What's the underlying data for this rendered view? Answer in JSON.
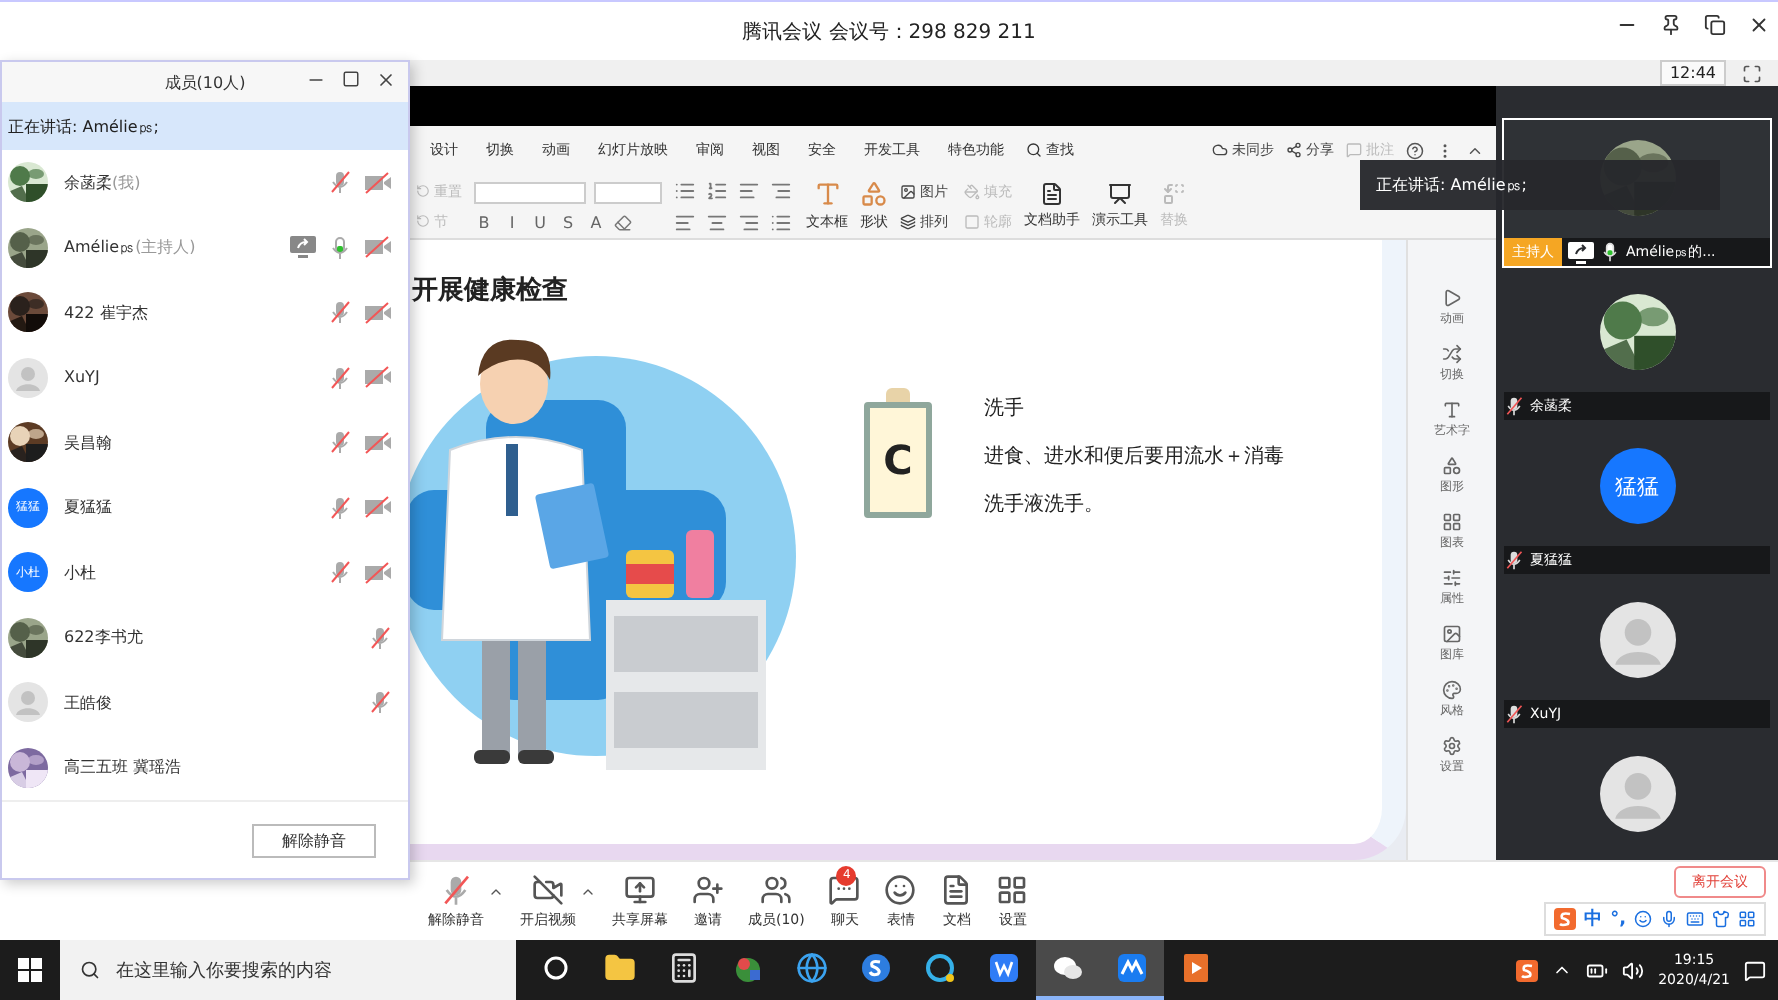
{
  "window": {
    "title": "腾讯会议 会议号：298 829 211"
  },
  "meeting_timer": "12:44",
  "ribbon": {
    "tabs": [
      "设计",
      "切换",
      "动画",
      "幻灯片放映",
      "审阅",
      "视图",
      "安全",
      "开发工具",
      "特色功能"
    ],
    "search": "查找",
    "actions": [
      {
        "label": "未同步",
        "kind": "cloud",
        "disabled": false
      },
      {
        "label": "分享",
        "kind": "share",
        "disabled": false
      },
      {
        "label": "批注",
        "kind": "comment",
        "disabled": true
      }
    ],
    "stack_tools": [
      {
        "label": "重置",
        "disabled": true
      },
      {
        "label": "节",
        "disabled": true
      }
    ],
    "format_buttons": [
      "B",
      "I",
      "U",
      "S",
      "A"
    ],
    "large_tools": [
      {
        "label": "文本框",
        "kind": "textbox"
      },
      {
        "label": "形状",
        "kind": "shape"
      }
    ],
    "grid_tools": [
      {
        "label": "图片",
        "kind": "picture",
        "disabled": false
      },
      {
        "label": "填充",
        "kind": "fill",
        "disabled": true
      },
      {
        "label": "排列",
        "kind": "arrange",
        "disabled": false
      },
      {
        "label": "轮廓",
        "kind": "outline",
        "disabled": true
      }
    ],
    "assist_tools": [
      {
        "label": "文档助手",
        "kind": "assistant",
        "disabled": false
      },
      {
        "label": "演示工具",
        "kind": "present",
        "disabled": false
      },
      {
        "label": "替换",
        "kind": "replace",
        "disabled": true
      }
    ]
  },
  "slide": {
    "title": "开展健康检查",
    "card_letter": "C",
    "heading": "洗手",
    "body": "进食、进水和便后要用流水＋消毒洗手液洗手。"
  },
  "side_panel": [
    {
      "label": "动画",
      "kind": "animation"
    },
    {
      "label": "切换",
      "kind": "transition"
    },
    {
      "label": "艺术字",
      "kind": "wordart"
    },
    {
      "label": "图形",
      "kind": "shape"
    },
    {
      "label": "图表",
      "kind": "chart"
    },
    {
      "label": "属性",
      "kind": "property"
    },
    {
      "label": "图库",
      "kind": "library"
    },
    {
      "label": "风格",
      "kind": "style"
    },
    {
      "label": "设置",
      "kind": "settings"
    }
  ],
  "speaking_tooltip": "正在讲话: Amélie㎰;",
  "members_panel": {
    "title": "成员(10人)",
    "speaking": "正在讲话: Amélie㎰;",
    "members": [
      {
        "name": "余菡柔",
        "tag": "(我)",
        "kind": "picture",
        "sharing": false,
        "muted": true,
        "camera_off": true
      },
      {
        "name": "Amélie㎰",
        "tag": "(主持人)",
        "kind": "picture",
        "sharing": true,
        "muted": false,
        "camera_off": true
      },
      {
        "name": "422 崔宇杰",
        "kind": "picture",
        "sharing": false,
        "muted": true,
        "camera_off": true
      },
      {
        "name": "XuYJ",
        "kind": "default",
        "sharing": false,
        "muted": true,
        "camera_off": true
      },
      {
        "name": "吴昌翰",
        "kind": "picture",
        "sharing": false,
        "muted": true,
        "camera_off": true
      },
      {
        "name": "夏猛猛",
        "kind": "text",
        "avatar_text": "猛猛",
        "sharing": false,
        "muted": true,
        "camera_off": true
      },
      {
        "name": "小杜",
        "kind": "text",
        "avatar_text": "小杜",
        "sharing": false,
        "muted": true,
        "camera_off": true
      },
      {
        "name": "622李书尤",
        "kind": "picture",
        "sharing": false,
        "muted": true,
        "camera_off": false
      },
      {
        "name": "王皓俊",
        "kind": "default",
        "sharing": false,
        "muted": true,
        "camera_off": false
      },
      {
        "name": "高三五班 冀瑶浩",
        "kind": "picture",
        "sharing": false,
        "camera_off": false
      }
    ],
    "unmute_button": "解除静音"
  },
  "video_tiles": [
    {
      "name": "Amélie㎰的...",
      "host_badge": "主持人",
      "sharing": true,
      "muted": false,
      "kind": "picture",
      "selected": true
    },
    {
      "name": "余菡柔",
      "sharing": false,
      "muted": true,
      "kind": "picture",
      "selected": false
    },
    {
      "name": "夏猛猛",
      "sharing": false,
      "muted": true,
      "kind": "text",
      "avatar_text": "猛猛",
      "selected": false
    },
    {
      "name": "XuYJ",
      "sharing": false,
      "muted": true,
      "kind": "default",
      "selected": false
    },
    {
      "kind": "default",
      "selected": false
    }
  ],
  "toolbar": [
    {
      "label": "解除静音",
      "kind": "mic-muted",
      "caret": true
    },
    {
      "label": "开启视频",
      "kind": "camera-off",
      "caret": true
    },
    {
      "label": "共享屏幕",
      "kind": "share-screen",
      "caret": false
    },
    {
      "label": "邀请",
      "kind": "invite",
      "caret": false
    },
    {
      "label": "成员(10)",
      "kind": "members",
      "caret": false
    },
    {
      "label": "聊天",
      "kind": "chat",
      "caret": false,
      "badge": "4"
    },
    {
      "label": "表情",
      "kind": "emoji",
      "caret": false
    },
    {
      "label": "文档",
      "kind": "document",
      "caret": false
    },
    {
      "label": "设置",
      "kind": "settings",
      "caret": false
    }
  ],
  "leave_button": "离开会议",
  "ime": {
    "mode": "中",
    "punctuation": "°,"
  },
  "taskbar": {
    "search_placeholder": "在这里输入你要搜索的内容",
    "apps": [
      {
        "kind": "taskview",
        "active": false
      },
      {
        "kind": "folder",
        "active": false
      },
      {
        "kind": "calculator",
        "active": false
      },
      {
        "kind": "game",
        "active": false
      },
      {
        "kind": "ie",
        "active": false
      },
      {
        "kind": "sbrowser",
        "active": false
      },
      {
        "kind": "bubble",
        "active": false
      },
      {
        "kind": "wps",
        "active": false
      },
      {
        "kind": "wechat",
        "active": true
      },
      {
        "kind": "meeting",
        "active": true
      },
      {
        "kind": "slides",
        "active": false
      }
    ],
    "time": "19:15",
    "date": "2020/4/21"
  }
}
